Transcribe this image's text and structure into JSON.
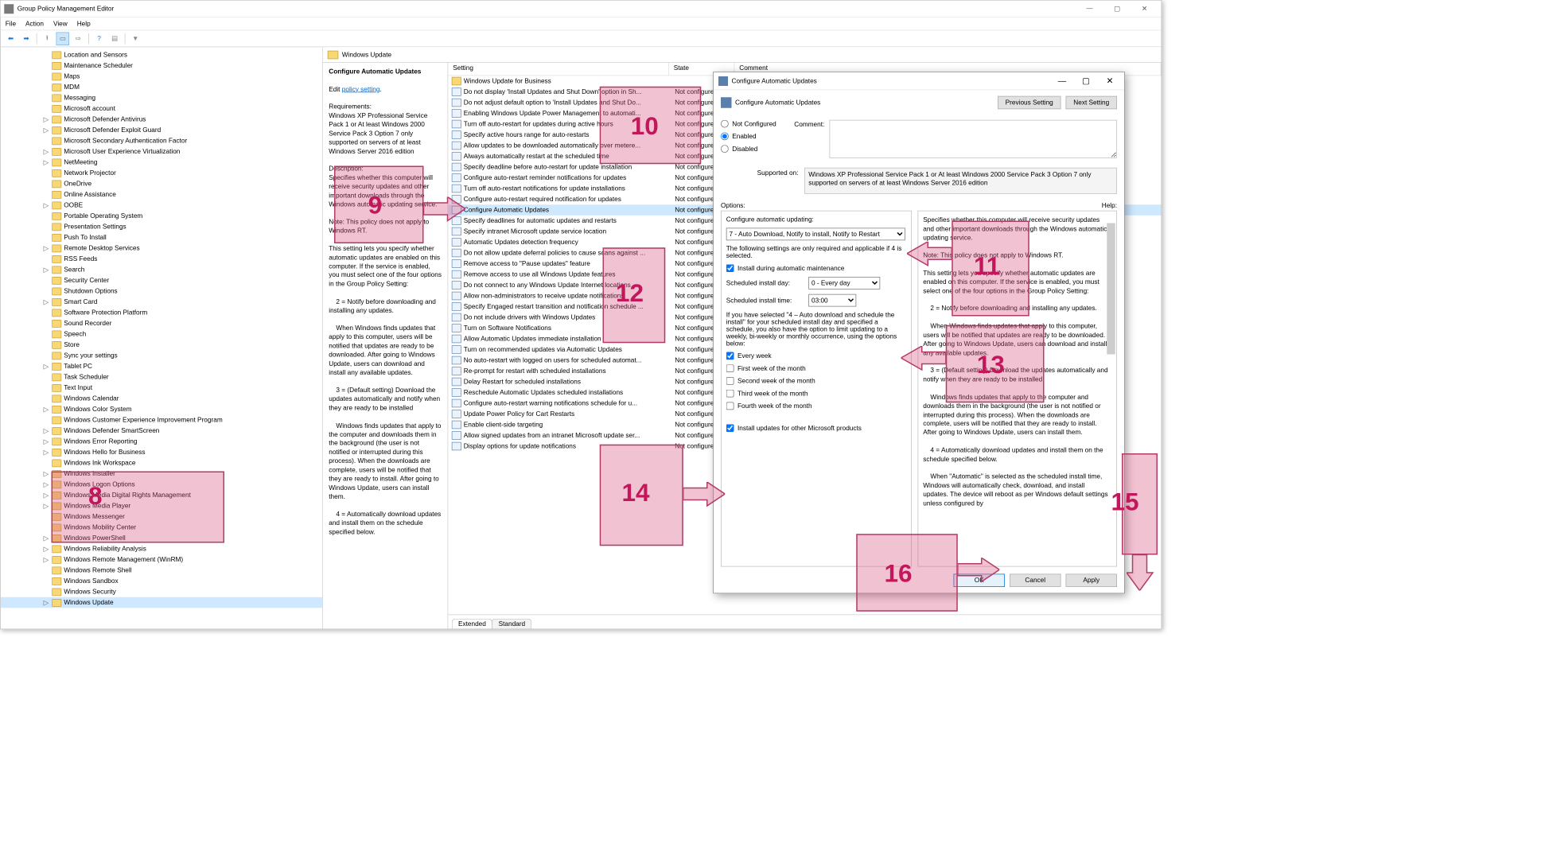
{
  "window": {
    "title": "Group Policy Management Editor",
    "menus": [
      "File",
      "Action",
      "View",
      "Help"
    ]
  },
  "tree_items": [
    "Location and Sensors",
    "Maintenance Scheduler",
    "Maps",
    "MDM",
    "Messaging",
    "Microsoft account",
    "Microsoft Defender Antivirus",
    "Microsoft Defender Exploit Guard",
    "Microsoft Secondary Authentication Factor",
    "Microsoft User Experience Virtualization",
    "NetMeeting",
    "Network Projector",
    "OneDrive",
    "Online Assistance",
    "OOBE",
    "Portable Operating System",
    "Presentation Settings",
    "Push To Install",
    "Remote Desktop Services",
    "RSS Feeds",
    "Search",
    "Security Center",
    "Shutdown Options",
    "Smart Card",
    "Software Protection Platform",
    "Sound Recorder",
    "Speech",
    "Store",
    "Sync your settings",
    "Tablet PC",
    "Task Scheduler",
    "Text Input",
    "Windows Calendar",
    "Windows Color System",
    "Windows Customer Experience Improvement Program",
    "Windows Defender SmartScreen",
    "Windows Error Reporting",
    "Windows Hello for Business",
    "Windows Ink Workspace",
    "Windows Installer",
    "Windows Logon Options",
    "Windows Media Digital Rights Management",
    "Windows Media Player",
    "Windows Messenger",
    "Windows Mobility Center",
    "Windows PowerShell",
    "Windows Reliability Analysis",
    "Windows Remote Management (WinRM)",
    "Windows Remote Shell",
    "Windows Sandbox",
    "Windows Security",
    "Windows Update"
  ],
  "tree_expandable": [
    "Microsoft Defender Antivirus",
    "Microsoft Defender Exploit Guard",
    "Microsoft User Experience Virtualization",
    "NetMeeting",
    "OOBE",
    "Remote Desktop Services",
    "Search",
    "Smart Card",
    "Tablet PC",
    "Windows Color System",
    "Windows Defender SmartScreen",
    "Windows Error Reporting",
    "Windows Hello for Business",
    "Windows Installer",
    "Windows Logon Options",
    "Windows Media Digital Rights Management",
    "Windows Media Player",
    "Windows PowerShell",
    "Windows Reliability Analysis",
    "Windows Remote Management (WinRM)",
    "Windows Update"
  ],
  "tree_selected": "Windows Update",
  "detail": {
    "header": "Windows Update",
    "setting_name": "Configure Automatic Updates",
    "edit_label": "Edit ",
    "edit_link": "policy setting",
    "req_label": "Requirements:",
    "req_text": "Windows XP Professional Service Pack 1 or At least Windows 2000 Service Pack 3 Option 7 only supported on servers of at least Windows Server 2016 edition",
    "desc_label": "Description:",
    "desc_p1": "Specifies whether this computer will receive security updates and other important downloads through the Windows automatic updating service.",
    "desc_note": "Note: This policy does not apply to Windows RT.",
    "desc_p2": "This setting lets you specify whether automatic updates are enabled on this computer. If the service is enabled, you must select one of the four options in the Group Policy Setting:",
    "desc_2": "2 = Notify before downloading and installing any updates.",
    "desc_2b": "When Windows finds updates that apply to this computer, users will be notified that updates are ready to be downloaded. After going to Windows Update, users can download and install any available updates.",
    "desc_3": "3 = (Default setting) Download the updates automatically and notify when they are ready to be installed",
    "desc_3b": "Windows finds updates that apply to the computer and downloads them in the background (the user is not notified or interrupted during this process). When the downloads are complete, users will be notified that they are ready to install. After going to Windows Update, users can install them.",
    "desc_4": "4 = Automatically download updates and install them on the schedule specified below."
  },
  "columns": {
    "setting": "Setting",
    "state": "State",
    "comment": "Comment"
  },
  "settings_folder": "Windows Update for Business",
  "settings": [
    "Do not display 'Install Updates and Shut Down' option in Sh...",
    "Do not adjust default option to 'Install Updates and Shut Do...",
    "Enabling Windows Update Power Management to automati...",
    "Turn off auto-restart for updates during active hours",
    "Specify active hours range for auto-restarts",
    "Allow updates to be downloaded automatically over metere...",
    "Always automatically restart at the scheduled time",
    "Specify deadline before auto-restart for update installation",
    "Configure auto-restart reminder notifications for updates",
    "Turn off auto-restart notifications for update installations",
    "Configure auto-restart required notification for updates",
    "Configure Automatic Updates",
    "Specify deadlines for automatic updates and restarts",
    "Specify intranet Microsoft update service location",
    "Automatic Updates detection frequency",
    "Do not allow update deferral policies to cause scans against ...",
    "Remove access to \"Pause updates\" feature",
    "Remove access to use all Windows Update features",
    "Do not connect to any Windows Update Internet locations",
    "Allow non-administrators to receive update notifications",
    "Specify Engaged restart transition and notification schedule ...",
    "Do not include drivers with Windows Updates",
    "Turn on Software Notifications",
    "Allow Automatic Updates immediate installation",
    "Turn on recommended updates via Automatic Updates",
    "No auto-restart with logged on users for scheduled automat...",
    "Re-prompt for restart with scheduled installations",
    "Delay Restart for scheduled installations",
    "Reschedule Automatic Updates scheduled installations",
    "Configure auto-restart warning notifications schedule for u...",
    "Update Power Policy for Cart Restarts",
    "Enable client-side targeting",
    "Allow signed updates from an intranet Microsoft update ser...",
    "Display options for update notifications"
  ],
  "settings_selected": 11,
  "state_text": "Not configured",
  "tabs": {
    "extended": "Extended",
    "standard": "Standard"
  },
  "dialog": {
    "title": "Configure Automatic Updates",
    "heading": "Configure Automatic Updates",
    "prev": "Previous Setting",
    "next": "Next Setting",
    "not_configured": "Not Configured",
    "enabled": "Enabled",
    "disabled": "Disabled",
    "comment_label": "Comment:",
    "supported_label": "Supported on:",
    "supported_text": "Windows XP Professional Service Pack 1 or At least Windows 2000 Service Pack 3 Option 7 only supported on servers of at least Windows Server 2016 edition",
    "options_label": "Options:",
    "help_label": "Help:",
    "cfg_label": "Configure automatic updating:",
    "cfg_value": "7 - Auto Download, Notify to install, Notify to Restart",
    "cfg_note": "The following settings are only required and applicable if 4 is selected.",
    "chk_maint": "Install during automatic maintenance",
    "day_label": "Scheduled install day:",
    "day_value": "0 - Every day",
    "time_label": "Scheduled install time:",
    "time_value": "03:00",
    "sched_note": "If you have selected \"4 – Auto download and schedule the install\" for your scheduled install day and specified a schedule, you also have the option to limit updating to a weekly, bi-weekly or monthly occurrence, using the options below:",
    "chk_every": "Every week",
    "chk_w1": "First week of the month",
    "chk_w2": "Second week of the month",
    "chk_w3": "Third week of the month",
    "chk_w4": "Fourth week of the month",
    "chk_other": "Install updates for other Microsoft products",
    "help_p1": "Specifies whether this computer will receive security updates and other important downloads through the Windows automatic updating service.",
    "help_note": "Note: This policy does not apply to Windows RT.",
    "help_p2": "This setting lets you specify whether automatic updates are enabled on this computer. If the service is enabled, you must select one of the four options in the Group Policy Setting:",
    "help_2": "2 = Notify before downloading and installing any updates.",
    "help_2b": "When Windows finds updates that apply to this computer, users will be notified that updates are ready to be downloaded. After going to Windows Update, users can download and install any available updates.",
    "help_3": "3 = (Default setting) Download the updates automatically and notify when they are ready to be installed",
    "help_3b": "Windows finds updates that apply to the computer and downloads them in the background (the user is not notified or interrupted during this process). When the downloads are complete, users will be notified that they are ready to install. After going to Windows Update, users can install them.",
    "help_4": "4 = Automatically download updates and install them on the schedule specified below.",
    "help_4b": "When \"Automatic\" is selected as the scheduled install time, Windows will automatically check, download, and install updates. The device will reboot as per Windows default settings unless configured by",
    "ok": "OK",
    "cancel": "Cancel",
    "apply": "Apply"
  },
  "annotations": {
    "n8": "8",
    "n9": "9",
    "n10": "10",
    "n11": "11",
    "n12": "12",
    "n13": "13",
    "n14": "14",
    "n15": "15",
    "n16": "16"
  }
}
